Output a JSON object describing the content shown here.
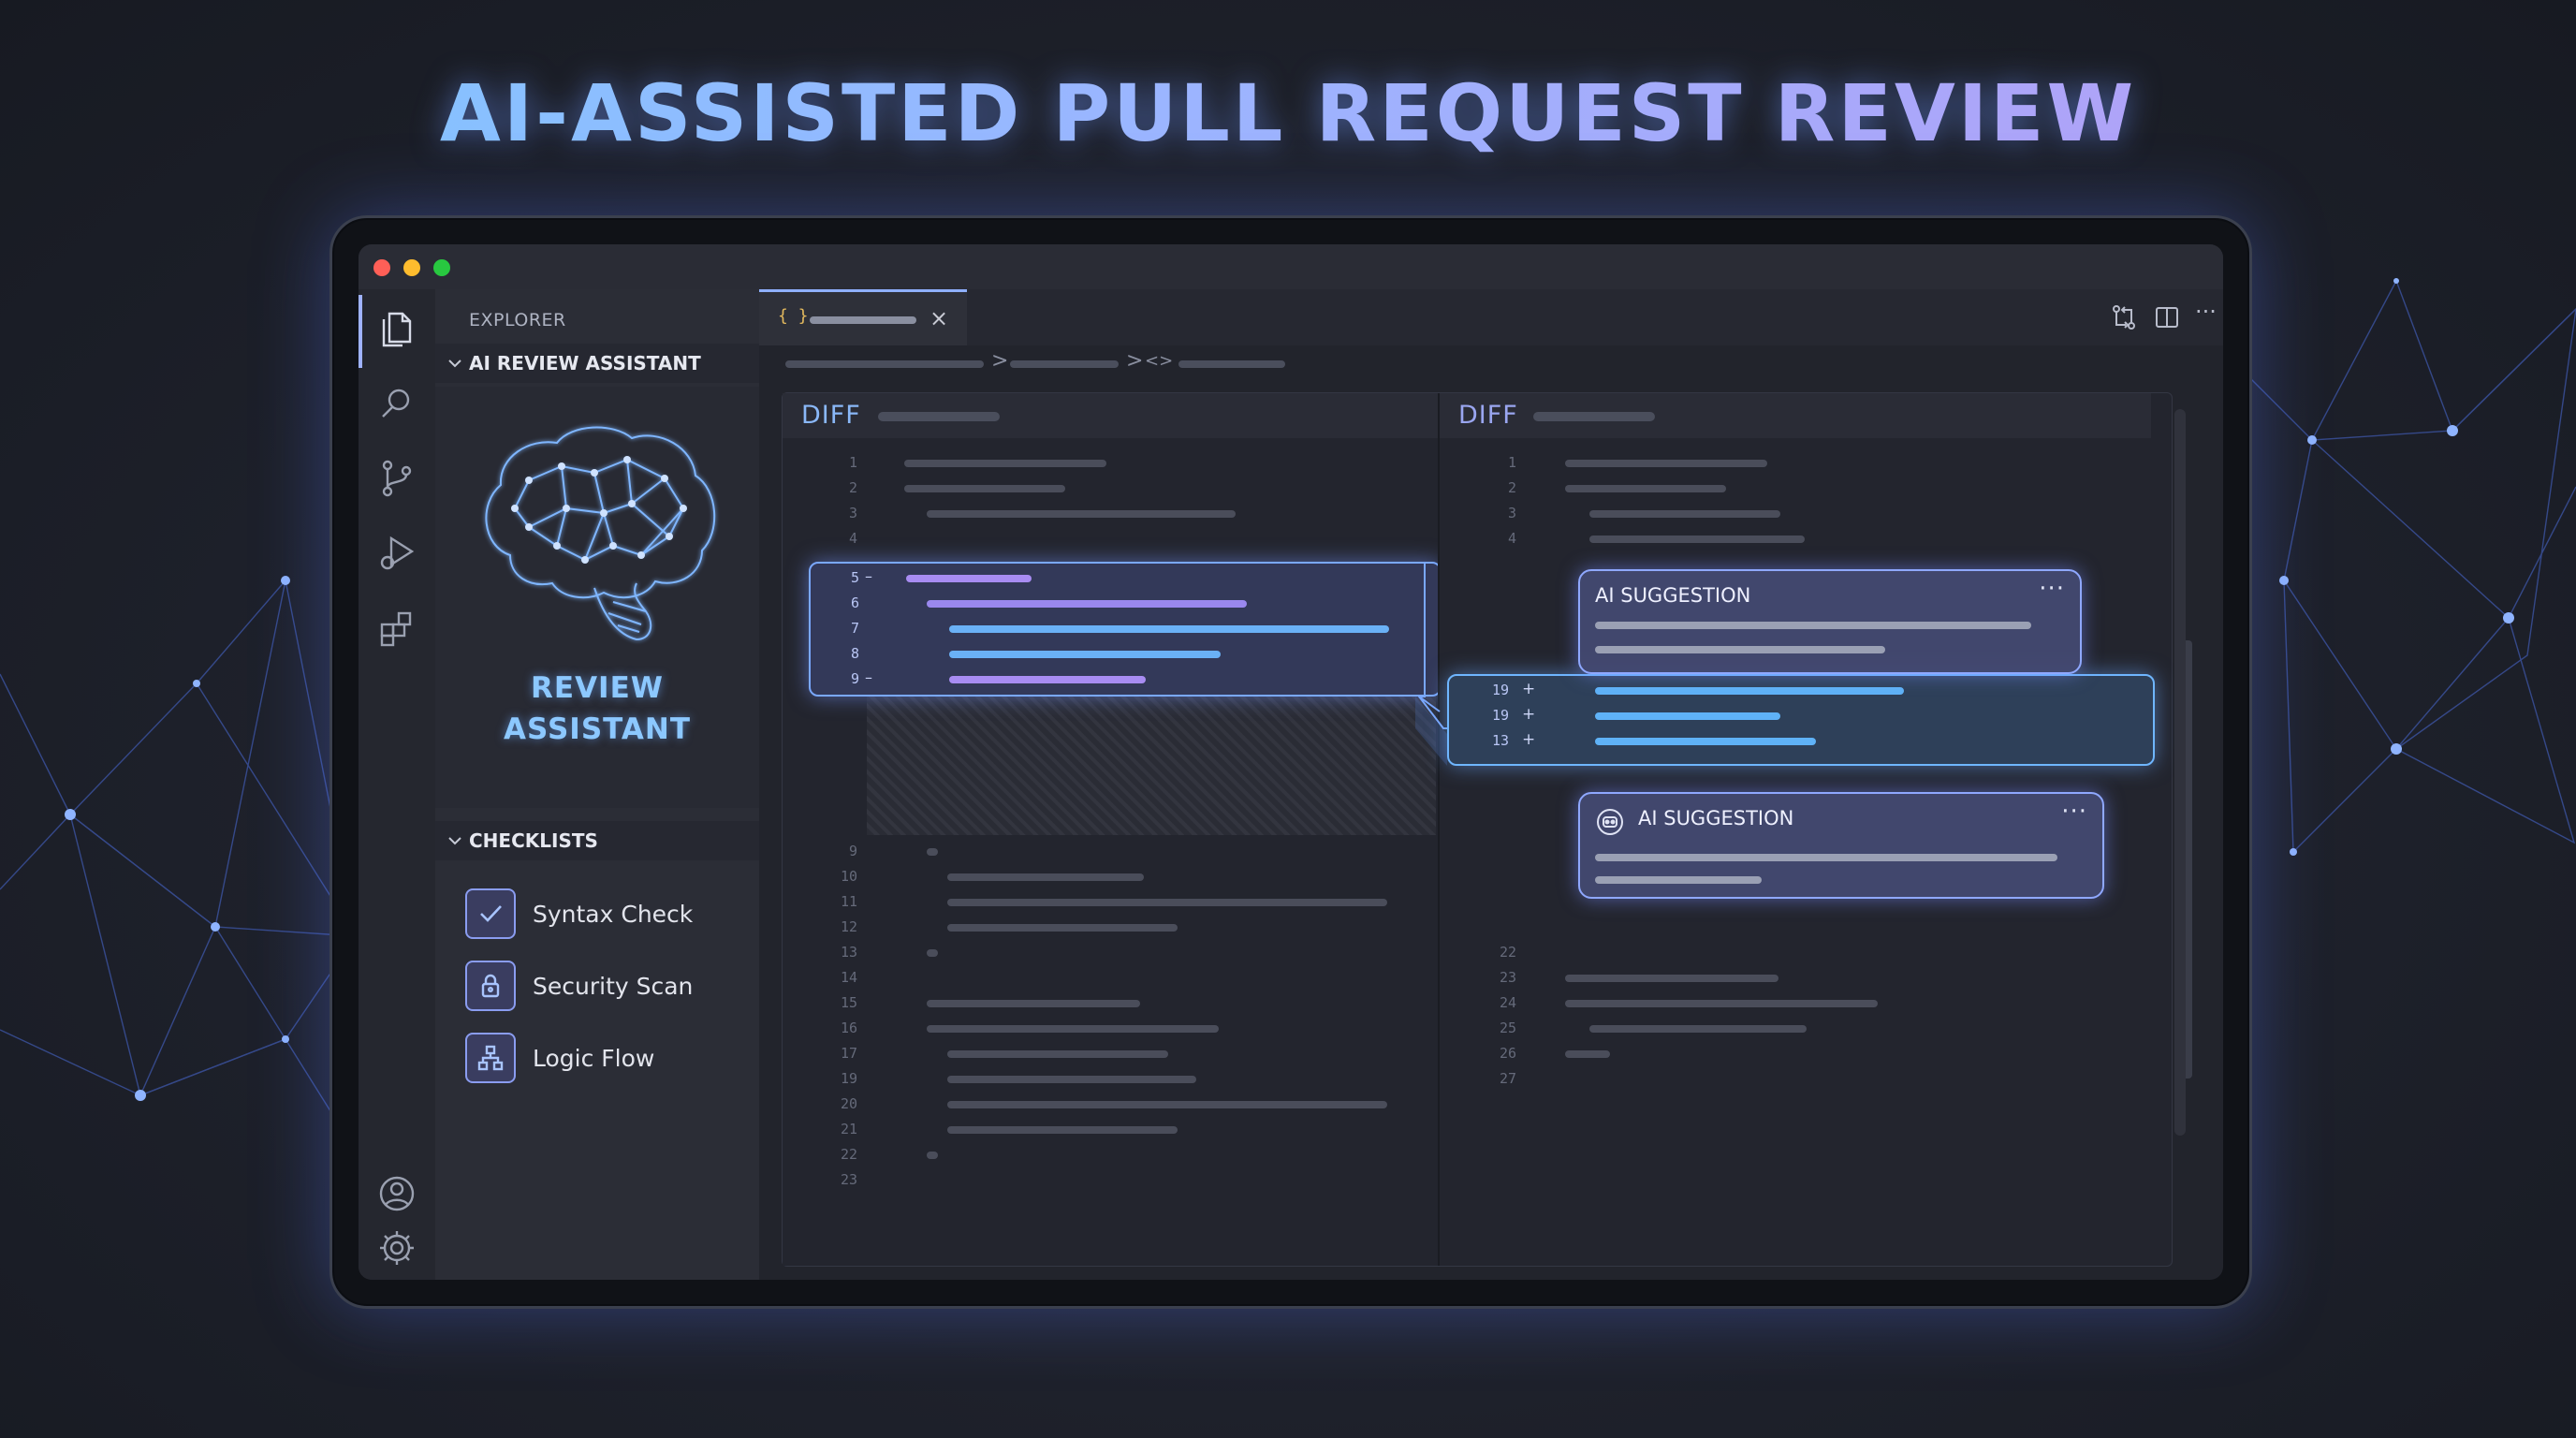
{
  "page": {
    "title": "AI-ASSISTED PULL REQUEST REVIEW"
  },
  "colors": {
    "accent_blue": "#7cc8ff",
    "accent_purple": "#b79bf5",
    "highlight_border": "#7aa8ff",
    "mac_close": "#ff5f57",
    "mac_minimize": "#febc2e",
    "mac_maximize": "#28c840"
  },
  "window": {
    "traffic_lights": [
      "close",
      "minimize",
      "maximize"
    ]
  },
  "activity_bar": {
    "top_icons": [
      "files-icon",
      "search-icon",
      "source-control-icon",
      "run-debug-icon",
      "extensions-icon"
    ],
    "bottom_icons": [
      "account-icon",
      "settings-gear-icon"
    ]
  },
  "sidebar": {
    "header": "EXPLORER",
    "assistant_section": "AI REVIEW ASSISTANT",
    "assistant_title_line1": "REVIEW",
    "assistant_title_line2": "ASSISTANT",
    "checklists_section": "CHECKLISTS",
    "checklists": [
      {
        "label": "Syntax Check",
        "icon": "checkmark-icon",
        "checked": true
      },
      {
        "label": "Security Scan",
        "icon": "lock-icon",
        "checked": false
      },
      {
        "label": "Logic Flow",
        "icon": "flowchart-icon",
        "checked": false
      }
    ]
  },
  "editor": {
    "tab": {
      "icon_text": "{ }",
      "close": "×"
    },
    "toolbar_icons": [
      "compare-changes-icon",
      "split-editor-icon",
      "more-icon"
    ],
    "more_glyph": "···",
    "breadcrumb_separators": [
      ">",
      ">"
    ],
    "breadcrumb_code_glyph": "<>",
    "left_pane": {
      "title": "DIFF",
      "line_numbers_top": [
        "1",
        "2",
        "3",
        "4"
      ],
      "line_numbers_changed": [
        "5",
        "6",
        "7",
        "8",
        "9"
      ],
      "changed_markers": {
        "5": "–",
        "9": "–"
      },
      "line_numbers_bottom": [
        "9",
        "10",
        "11",
        "12",
        "13",
        "14",
        "15",
        "16",
        "17",
        "19",
        "20",
        "21",
        "22",
        "23"
      ]
    },
    "right_pane": {
      "title": "DIFF",
      "line_numbers_top": [
        "1",
        "2",
        "3",
        "4"
      ],
      "line_numbers_changed": [
        "19",
        "19",
        "13"
      ],
      "added_marker": "+",
      "line_numbers_bottom": [
        "22",
        "23",
        "24",
        "25",
        "26",
        "27"
      ]
    },
    "suggestions": [
      {
        "title": "AI SUGGESTION",
        "more": "···"
      },
      {
        "title": "AI SUGGESTION",
        "more": "···",
        "icon": "robot-icon"
      }
    ]
  }
}
